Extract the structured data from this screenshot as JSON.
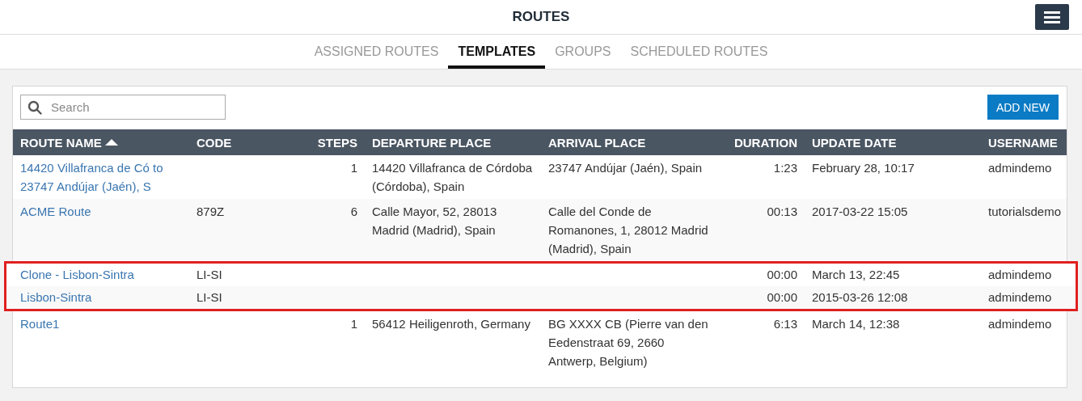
{
  "header": {
    "title": "ROUTES"
  },
  "tabs": [
    {
      "label": "ASSIGNED ROUTES",
      "selected": false
    },
    {
      "label": "TEMPLATES",
      "selected": true
    },
    {
      "label": "GROUPS",
      "selected": false
    },
    {
      "label": "SCHEDULED ROUTES",
      "selected": false
    }
  ],
  "search": {
    "placeholder": "Search"
  },
  "add_button": "ADD NEW",
  "table": {
    "columns": [
      {
        "label": "ROUTE NAME",
        "sorted": true
      },
      {
        "label": "CODE",
        "sorted": false
      },
      {
        "label": "STEPS",
        "sorted": false
      },
      {
        "label": "DEPARTURE PLACE",
        "sorted": false
      },
      {
        "label": "ARRIVAL PLACE",
        "sorted": false
      },
      {
        "label": "DURATION",
        "sorted": false
      },
      {
        "label": "UPDATE DATE",
        "sorted": false
      },
      {
        "label": "USERNAME",
        "sorted": false
      }
    ],
    "rows": [
      {
        "highlighted": false,
        "cells": [
          "14420 Villafranca de Có to 23747 Andújar (Jaén), S",
          "",
          "1",
          "14420 Villafranca de Córdoba (Córdoba), Spain",
          "23747 Andújar (Jaén), Spain",
          "1:23",
          "February 28, 10:17",
          "admindemo"
        ]
      },
      {
        "highlighted": false,
        "cells": [
          "ACME Route",
          "879Z",
          "6",
          "Calle Mayor, 52, 28013 Madrid (Madrid), Spain",
          "Calle del Conde de Romanones, 1, 28012 Madrid (Madrid), Spain",
          "00:13",
          "2017-03-22 15:05",
          "tutorialsdemo"
        ]
      },
      {
        "highlighted": true,
        "cells": [
          "Clone - Lisbon-Sintra",
          "LI-SI",
          "",
          "",
          "",
          "00:00",
          "March 13, 22:45",
          "admindemo"
        ]
      },
      {
        "highlighted": true,
        "cells": [
          "Lisbon-Sintra",
          "LI-SI",
          "",
          "",
          "",
          "00:00",
          "2015-03-26 12:08",
          "admindemo"
        ]
      },
      {
        "highlighted": false,
        "cells": [
          "Route1",
          "",
          "1",
          "56412 Heiligenroth, Germany",
          "BG XXXX CB (Pierre van den Eedenstraat 69, 2660 Antwerp, Belgium)",
          "6:13",
          "March 14, 12:38",
          "admindemo"
        ]
      }
    ]
  }
}
